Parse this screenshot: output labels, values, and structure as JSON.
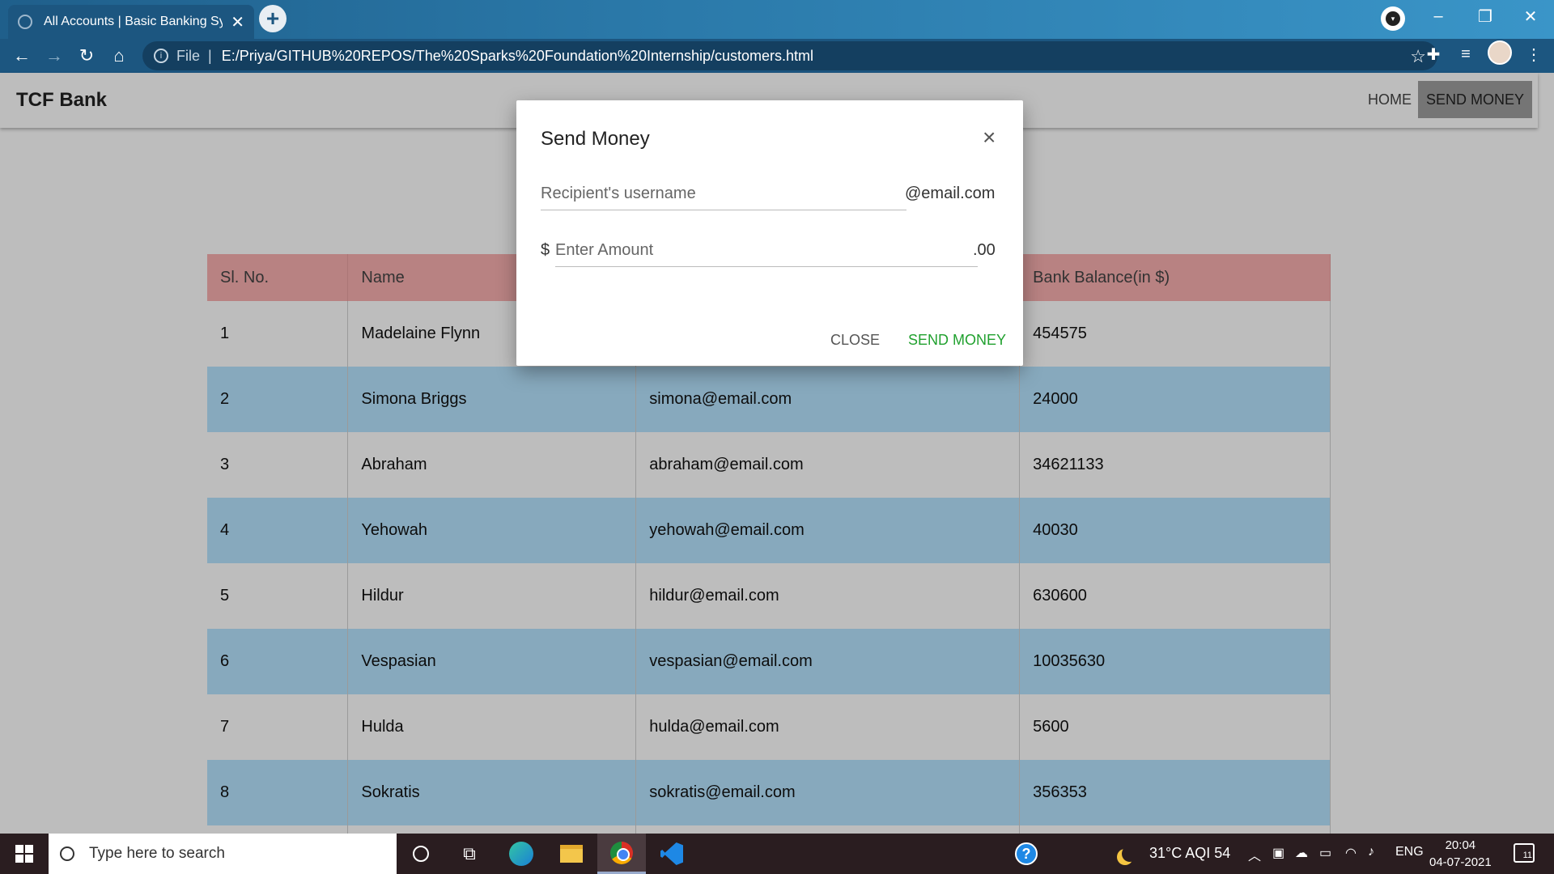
{
  "browser": {
    "tab_title": "All Accounts | Basic Banking Syst",
    "tab_close": "✕",
    "new_tab": "+",
    "file_label": "File",
    "separator": "|",
    "url": "E:/Priya/GITHUB%20REPOS/The%20Sparks%20Foundation%20Internship/customers.html",
    "window": {
      "minimize": "–",
      "restore": "❐",
      "close": "✕"
    }
  },
  "navbar": {
    "brand": "TCF Bank",
    "home": "HOME",
    "send_money": "SEND MONEY"
  },
  "table": {
    "headers": [
      "Sl. No.",
      "Name",
      "",
      "Bank Balance(in $)"
    ],
    "rows": [
      {
        "no": "1",
        "name": "Madelaine Flynn",
        "email": "",
        "balance": "454575"
      },
      {
        "no": "2",
        "name": "Simona Briggs",
        "email": "simona@email.com",
        "balance": "24000"
      },
      {
        "no": "3",
        "name": "Abraham",
        "email": "abraham@email.com",
        "balance": "34621133"
      },
      {
        "no": "4",
        "name": "Yehowah",
        "email": "yehowah@email.com",
        "balance": "40030"
      },
      {
        "no": "5",
        "name": "Hildur",
        "email": "hildur@email.com",
        "balance": "630600"
      },
      {
        "no": "6",
        "name": "Vespasian",
        "email": "vespasian@email.com",
        "balance": "10035630"
      },
      {
        "no": "7",
        "name": "Hulda",
        "email": "hulda@email.com",
        "balance": "5600"
      },
      {
        "no": "8",
        "name": "Sokratis",
        "email": "sokratis@email.com",
        "balance": "356353"
      }
    ]
  },
  "modal": {
    "title": "Send Money",
    "close_x": "×",
    "recipient_placeholder": "Recipient's username",
    "recipient_suffix": "@email.com",
    "amount_prefix": "$",
    "amount_placeholder": "Enter Amount",
    "amount_suffix": ".00",
    "close_button": "CLOSE",
    "send_button": "SEND MONEY"
  },
  "taskbar": {
    "search_placeholder": "Type here to search",
    "weather": "31°C AQI 54",
    "language": "ENG",
    "time": "20:04",
    "date": "04-07-2021",
    "notification_count": "11"
  },
  "colors": {
    "header_bg": "#f8b0b0",
    "row_alt_bg": "#b6e4ff",
    "send_green": "#21a12f"
  }
}
